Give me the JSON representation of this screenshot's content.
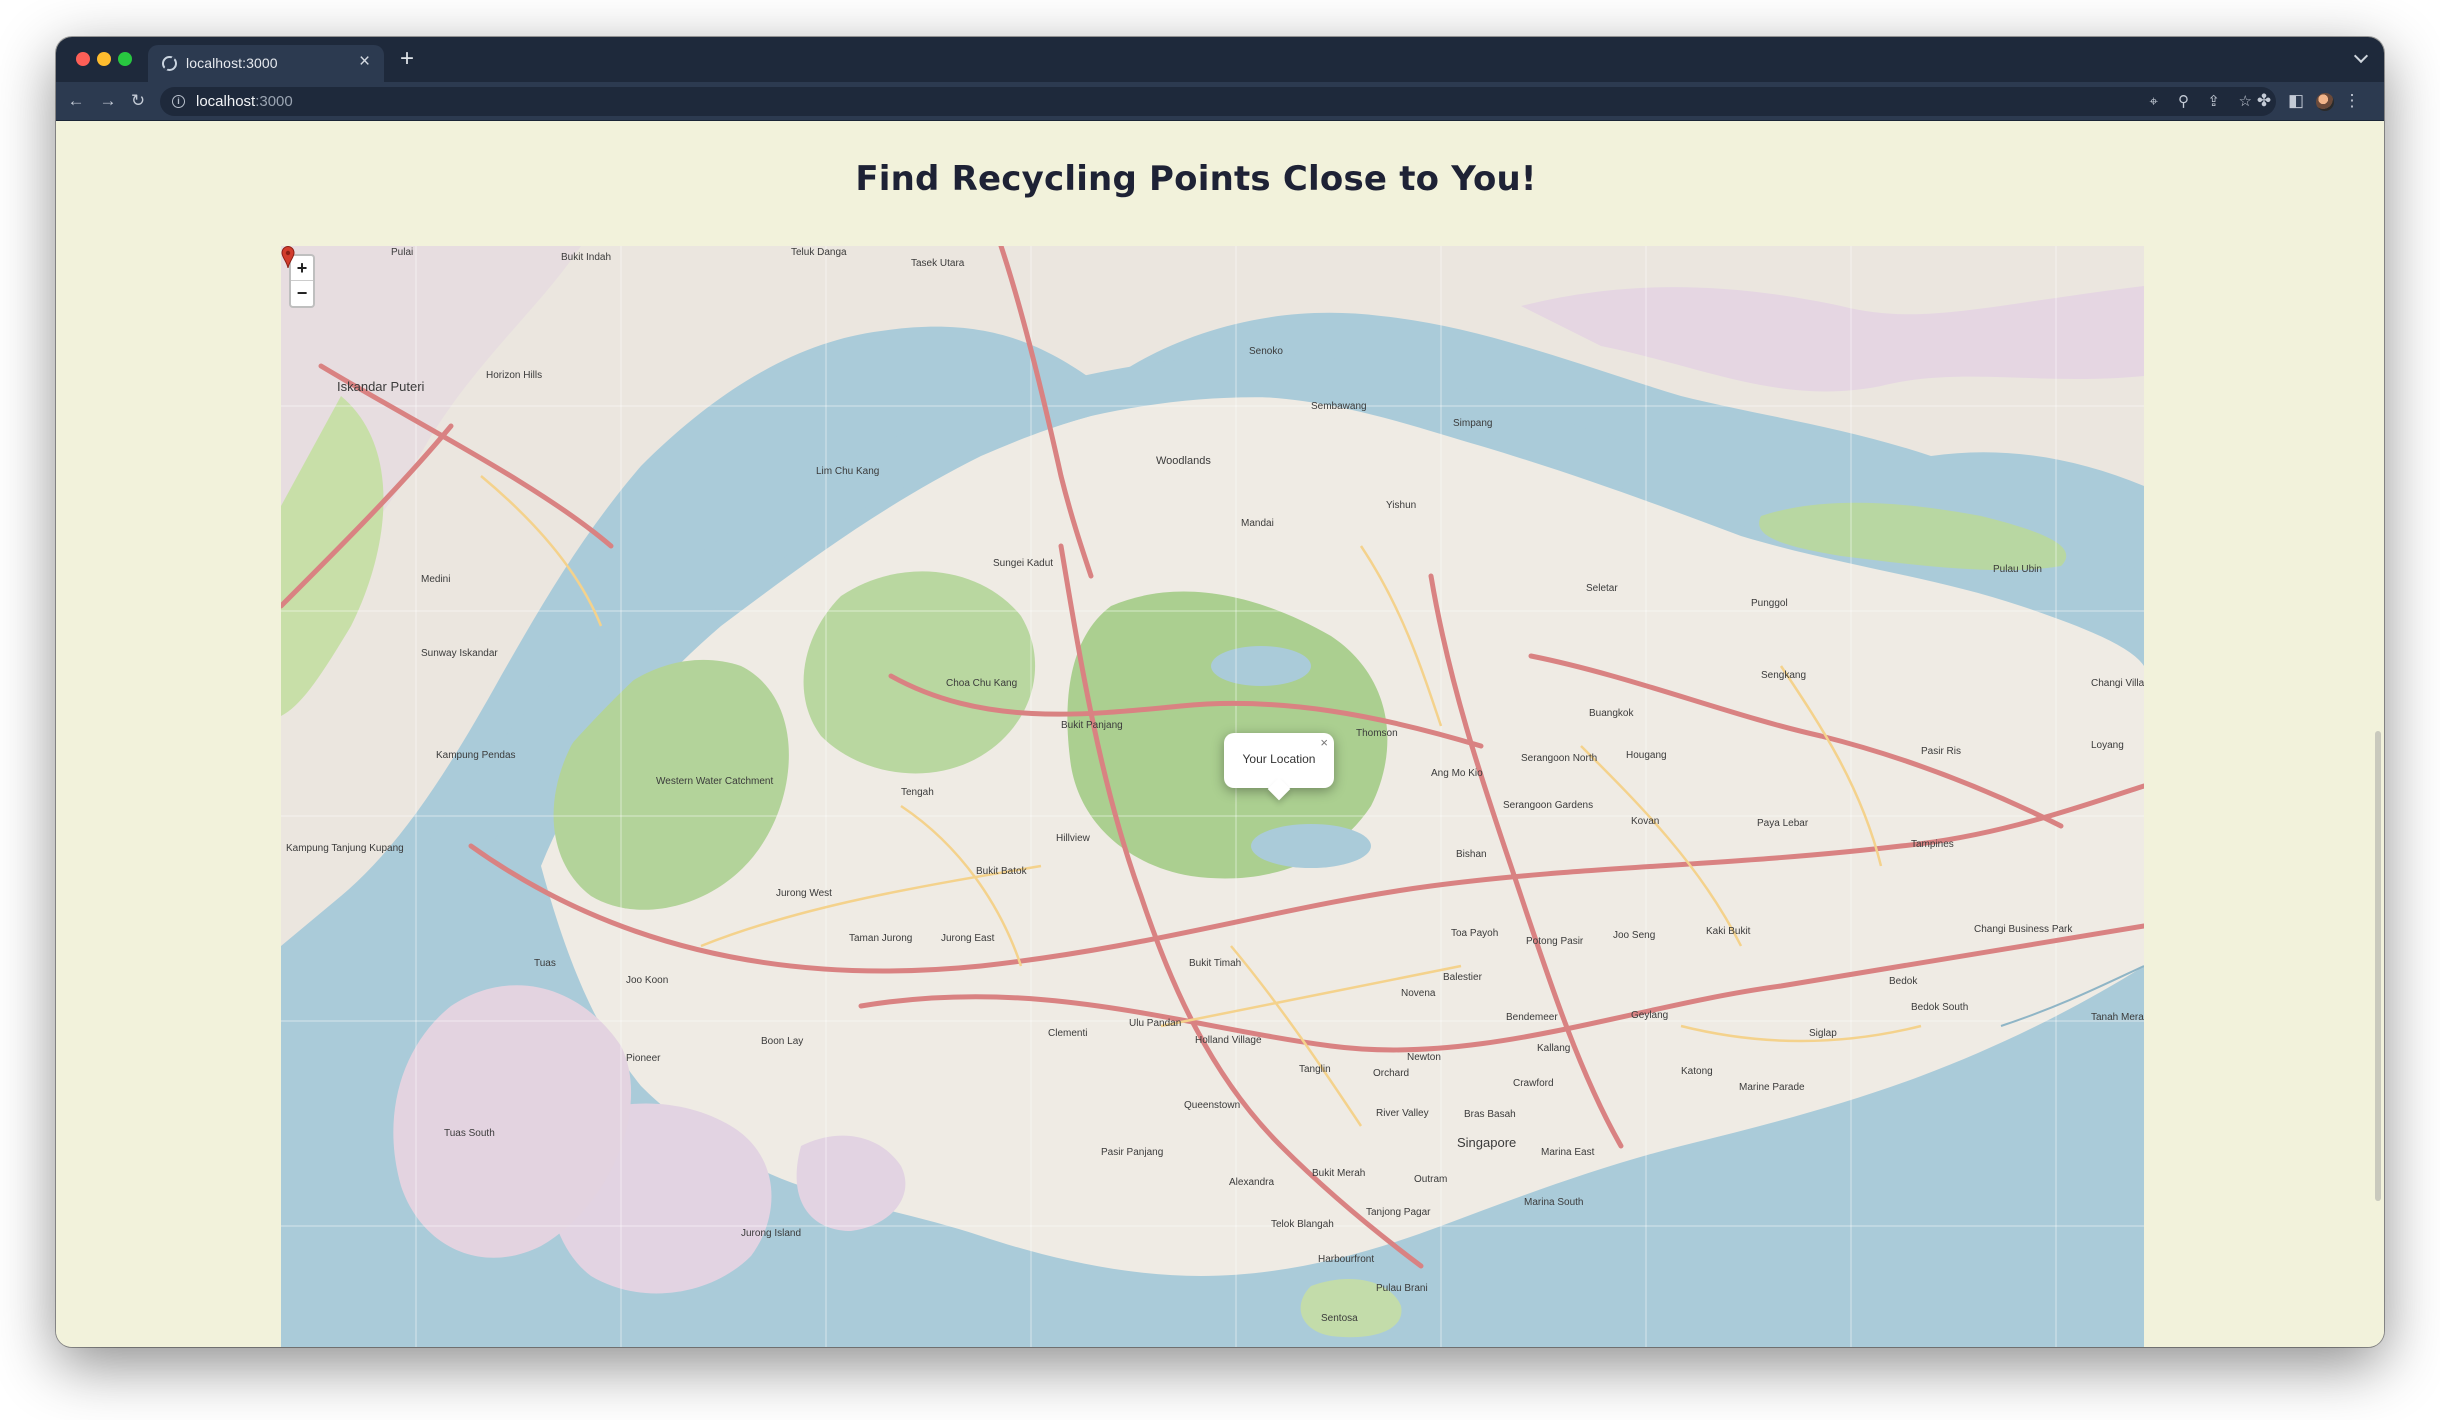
{
  "browser": {
    "tab_title": "localhost:3000",
    "url_host": "localhost",
    "url_port": ":3000",
    "new_tab_label": "+",
    "tab_close_label": "×"
  },
  "page": {
    "title": "Find Recycling Points Close to You!"
  },
  "map": {
    "zoom_in_label": "+",
    "zoom_out_label": "−",
    "popup_text": "Your Location",
    "popup_close_label": "×",
    "labels": [
      "Pulai",
      "Bukit Indah",
      "Teluk Danga",
      "Tasek Utara",
      "Iskandar Puteri",
      "Horizon Hills",
      "Senoko",
      "Sembawang",
      "Simpang",
      "Woodlands",
      "Lim Chu Kang",
      "Mandai",
      "Yishun",
      "Sungei Kadut",
      "Medini",
      "Sunway Iskandar",
      "Choa Chu Kang",
      "Bukit Panjang",
      "Seletar",
      "Punggol",
      "Sengkang",
      "Buangkok",
      "Pasir Ris",
      "Changi Village",
      "Loyang",
      "Thomson",
      "Ang Mo Kio",
      "Hougang",
      "Serangoon North",
      "Serangoon Gardens",
      "Kovan",
      "Paya Lebar",
      "Tampines",
      "Western Water Catchment",
      "Tengah",
      "Hillview",
      "Bishan",
      "Kampung Pendas",
      "Kampung Tanjung Kupang",
      "Bukit Batok",
      "Jurong West",
      "Taman Jurong",
      "Jurong East",
      "Toa Payoh",
      "Potong Pasir",
      "Joo Seng",
      "Kaki Bukit",
      "Tuas",
      "Joo Koon",
      "Bukit Timah",
      "Novena",
      "Balestier",
      "Bendemeer",
      "Kallang",
      "Geylang",
      "Bedok",
      "Bedok South",
      "Siglap",
      "Changi Business Park",
      "Boon Lay",
      "Pioneer",
      "Clementi",
      "Ulu Pandan",
      "Holland Village",
      "Newton",
      "Orchard",
      "Tanglin",
      "Crawford",
      "Katong",
      "Marine Parade",
      "Tuas South",
      "River Valley",
      "Bras Basah",
      "Singapore",
      "Marina East",
      "Pasir Panjang",
      "Queenstown",
      "Alexandra",
      "Bukit Merah",
      "Outram",
      "Tanjong Pagar",
      "Marina South",
      "Telok Blangah",
      "Harbourfront",
      "Jurong Island",
      "Sentosa",
      "Pulau Brani",
      "Pulau Ubin",
      "Tanah Merah"
    ]
  }
}
